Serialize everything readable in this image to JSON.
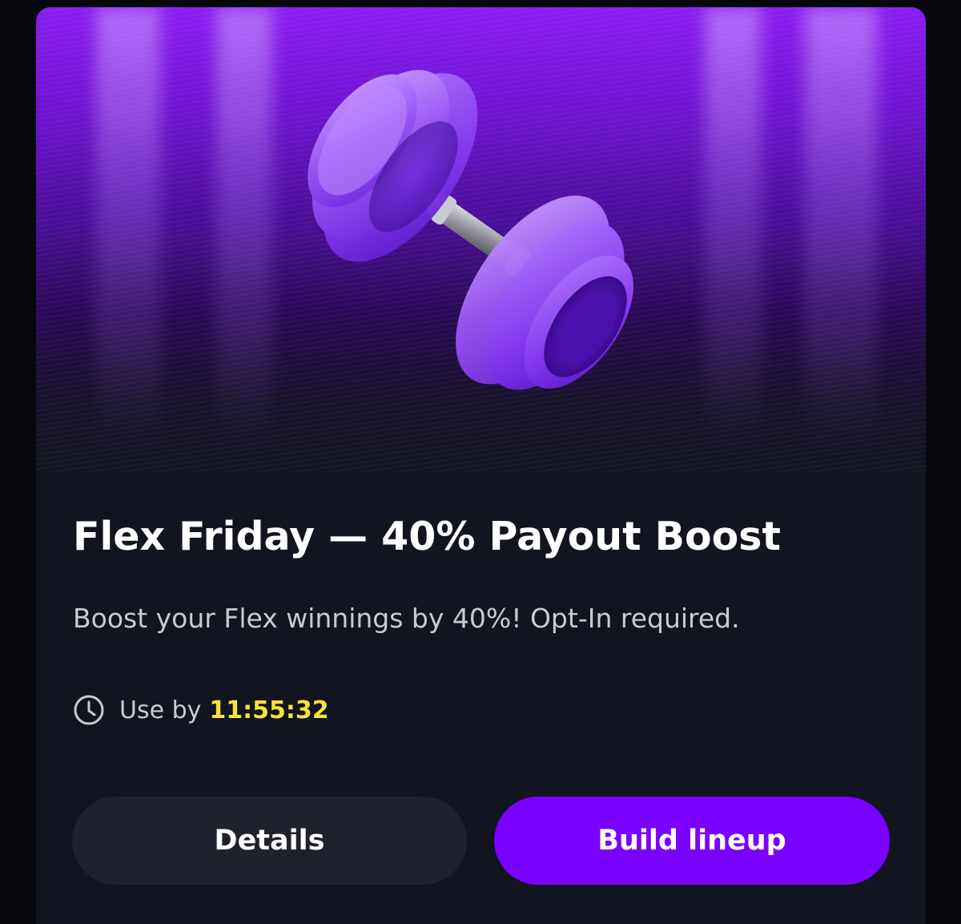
{
  "promo": {
    "title": "Flex Friday — 40% Payout Boost",
    "description": "Boost your Flex winnings by 40%! Opt-In required.",
    "image_icon": "dumbbell-icon"
  },
  "timer": {
    "icon": "clock-icon",
    "label": "Use by",
    "value": "11:55:32"
  },
  "buttons": {
    "details_label": "Details",
    "build_label": "Build lineup"
  },
  "colors": {
    "accent": "#7a00ff",
    "timer_highlight": "#f5e43a",
    "card_background": "#12141f",
    "secondary_button": "#1f212d"
  }
}
